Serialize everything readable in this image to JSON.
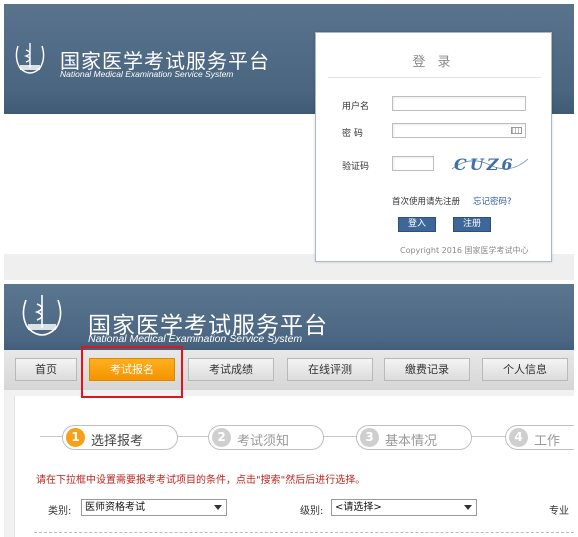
{
  "top_screen": {
    "site_title_cn": "国家医学考试服务平台",
    "site_title_en": "National Medical Examination Service System",
    "login": {
      "title": "登 录",
      "username_label": "用户名",
      "password_label": "密 码",
      "captcha_label": "验证码",
      "captcha_text": "CUZ6",
      "first_use_text": "首次使用请先注册",
      "forgot_password_link": "忘记密码?",
      "login_button": "登入",
      "register_button": "注册",
      "copyright": "Copyright 2016 国家医学考试中心"
    }
  },
  "bottom_screen": {
    "site_title_cn": "国家医学考试服务平台",
    "site_title_en": "National Medical Examination Service System",
    "nav_tabs": [
      "首页",
      "考试报名",
      "考试成绩",
      "在线评测",
      "缴费记录",
      "个人信息"
    ],
    "active_tab": "考试报名",
    "steps": [
      {
        "num": "1",
        "label": "选择报考"
      },
      {
        "num": "2",
        "label": "考试须知"
      },
      {
        "num": "3",
        "label": "基本情况"
      },
      {
        "num": "4",
        "label": "工作"
      }
    ],
    "hint": "请在下拉框中设置需要报考考试项目的条件，点击\"搜索\"然后后进行选择。",
    "filters": {
      "category_label": "类别:",
      "category_value": "医师资格考试",
      "level_label": "级别:",
      "level_value": "<请选择>",
      "major_label": "专业"
    }
  },
  "colors": {
    "banner": "#4b6682",
    "active_tab": "#f59300",
    "highlight_box": "#e0141a",
    "hint_text": "#c0261d",
    "button": "#3d6699"
  }
}
